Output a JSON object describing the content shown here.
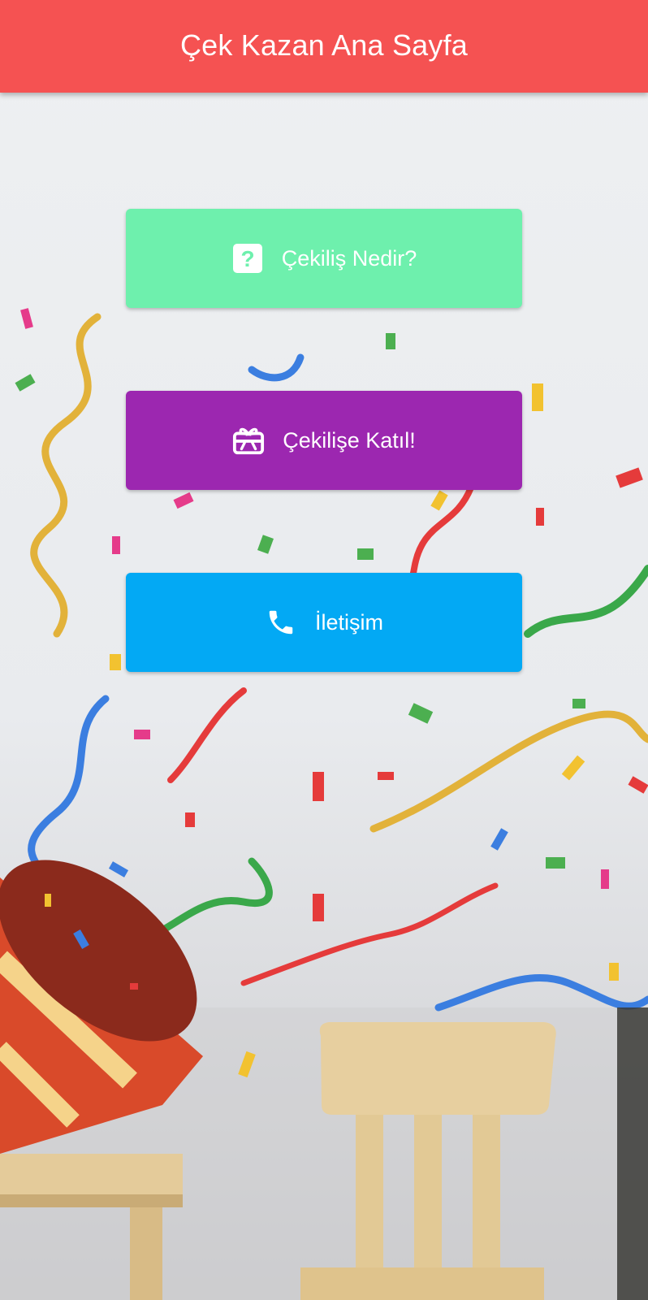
{
  "appbar": {
    "title": "Çek Kazan Ana Sayfa",
    "color": "#f55252"
  },
  "menu": {
    "items": [
      {
        "label": "Çekiliş Nedir?",
        "icon": "question-square-icon",
        "color": "#6ef0ad"
      },
      {
        "label": "Çekilişe Katıl!",
        "icon": "gift-card-icon",
        "color": "#9c27b0"
      },
      {
        "label": "İletişim",
        "icon": "phone-icon",
        "color": "#03a9f4"
      }
    ]
  },
  "background": {
    "description_icon": "party-confetti-background"
  }
}
